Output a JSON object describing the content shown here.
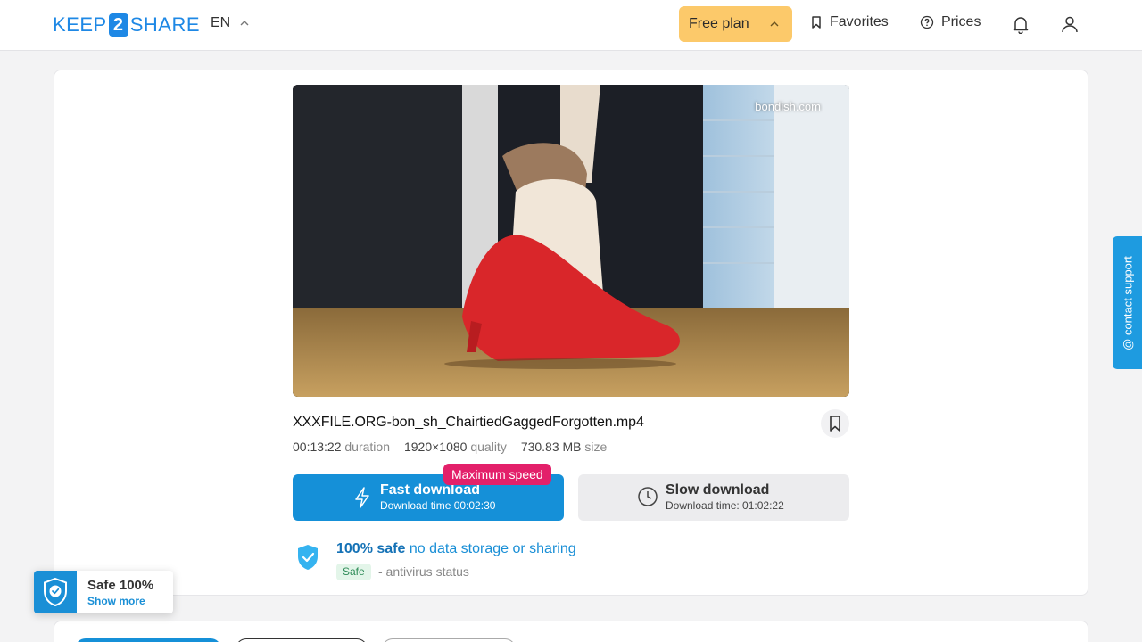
{
  "header": {
    "logo_left": "KEEP",
    "logo_mid": "2",
    "logo_right": "SHARE",
    "language": "EN",
    "plan_label": "Free plan",
    "favorites_label": "Favorites",
    "prices_label": "Prices"
  },
  "file": {
    "watermark": "bondish.com",
    "name": "XXXFILE.ORG-bon_sh_ChairtiedGaggedForgotten.mp4",
    "duration_value": "00:13:22",
    "duration_label": "duration",
    "quality_value": "1920×1080",
    "quality_label": "quality",
    "size_value": "730.83 MB",
    "size_label": "size"
  },
  "download": {
    "badge": "Maximum speed",
    "fast_title": "Fast download",
    "fast_time": "Download time 00:02:30",
    "slow_title": "Slow download",
    "slow_time": "Download time: 01:02:22"
  },
  "safety": {
    "bold": "100% safe",
    "text": "no data storage or sharing",
    "badge": "Safe",
    "status": "- antivirus status"
  },
  "support": {
    "label": "@ contact support"
  },
  "safe_widget": {
    "title": "Safe 100%",
    "more": "Show more"
  },
  "colors": {
    "brand": "#1e88e5",
    "fast": "#1590d8",
    "plan": "#fcc96a",
    "badge": "#e3206a"
  }
}
